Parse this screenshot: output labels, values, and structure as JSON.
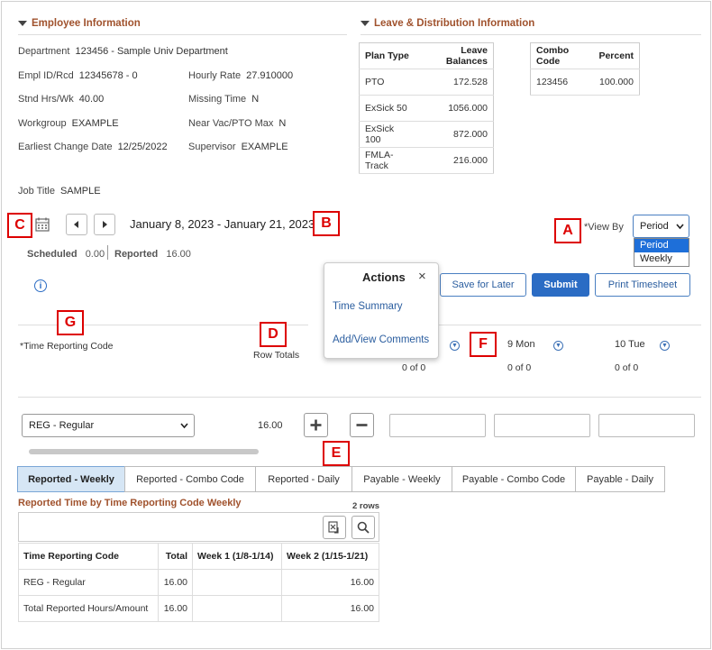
{
  "employee_section": {
    "title": "Employee Information",
    "department_label": "Department",
    "department_value": "123456 - Sample Univ Department",
    "empl_id_label": "Empl ID/Rcd",
    "empl_id_value": "12345678 - 0",
    "hourly_rate_label": "Hourly Rate",
    "hourly_rate_value": "27.910000",
    "stnd_hrs_label": "Stnd Hrs/Wk",
    "stnd_hrs_value": "40.00",
    "missing_time_label": "Missing Time",
    "missing_time_value": "N",
    "workgroup_label": "Workgroup",
    "workgroup_value": "EXAMPLE",
    "near_vac_label": "Near Vac/PTO Max",
    "near_vac_value": "N",
    "earliest_change_label": "Earliest Change Date",
    "earliest_change_value": "12/25/2022",
    "supervisor_label": "Supervisor",
    "supervisor_value": "EXAMPLE",
    "job_title_label": "Job Title",
    "job_title_value": "SAMPLE"
  },
  "leave_section": {
    "title": "Leave & Distribution Information",
    "balances_headers": [
      "Plan Type",
      "Leave Balances"
    ],
    "balances_rows": [
      [
        "PTO",
        "172.528"
      ],
      [
        "ExSick 50",
        "1056.000"
      ],
      [
        "ExSick 100",
        "872.000"
      ],
      [
        "FMLA-Track",
        "216.000"
      ]
    ],
    "combo_headers": [
      "Combo Code",
      "Percent"
    ],
    "combo_rows": [
      [
        "123456",
        "100.000"
      ]
    ]
  },
  "period": {
    "date_range": "January 8, 2023 - January 21, 2023",
    "scheduled_label": "Scheduled",
    "scheduled_value": "0.00",
    "reported_label": "Reported",
    "reported_value": "16.00",
    "view_by_label": "*View By",
    "view_by_selected": "Period",
    "view_by_options": [
      "Period",
      "Weekly"
    ]
  },
  "actions_popup": {
    "title": "Actions",
    "close": "×",
    "items": [
      "Time Summary",
      "Add/View Comments"
    ]
  },
  "buttons": {
    "save_for_later": "Save for Later",
    "submit": "Submit",
    "print_timesheet": "Print Timesheet"
  },
  "grid": {
    "trc_header": "*Time Reporting Code",
    "row_totals_header": "Row Totals",
    "days": [
      {
        "label": "",
        "sub": "0 of 0"
      },
      {
        "label": "9 Mon",
        "sub": "0 of 0"
      },
      {
        "label": "10 Tue",
        "sub": "0 of 0"
      }
    ],
    "trc_selected": "REG - Regular",
    "row_total": "16.00"
  },
  "callouts": [
    "A",
    "B",
    "C",
    "D",
    "E",
    "F",
    "G"
  ],
  "tabs": [
    "Reported - Weekly",
    "Reported - Combo Code",
    "Reported - Daily",
    "Payable - Weekly",
    "Payable - Combo Code",
    "Payable - Daily"
  ],
  "reported_time": {
    "title": "Reported Time by Time Reporting Code Weekly",
    "row_count": "2 rows",
    "headers": [
      "Time Reporting Code",
      "Total",
      "Week 1 (1/8-1/14)",
      "Week 2 (1/15-1/21)"
    ],
    "rows": [
      [
        "REG - Regular",
        "16.00",
        "",
        "16.00"
      ],
      [
        "Total Reported Hours/Amount",
        "16.00",
        "",
        "16.00"
      ]
    ]
  },
  "colors": {
    "section_header": "#a0522d",
    "accent_blue": "#2b6cc4",
    "callout_red": "#dd0000",
    "active_tab": "#d6e6f5"
  }
}
